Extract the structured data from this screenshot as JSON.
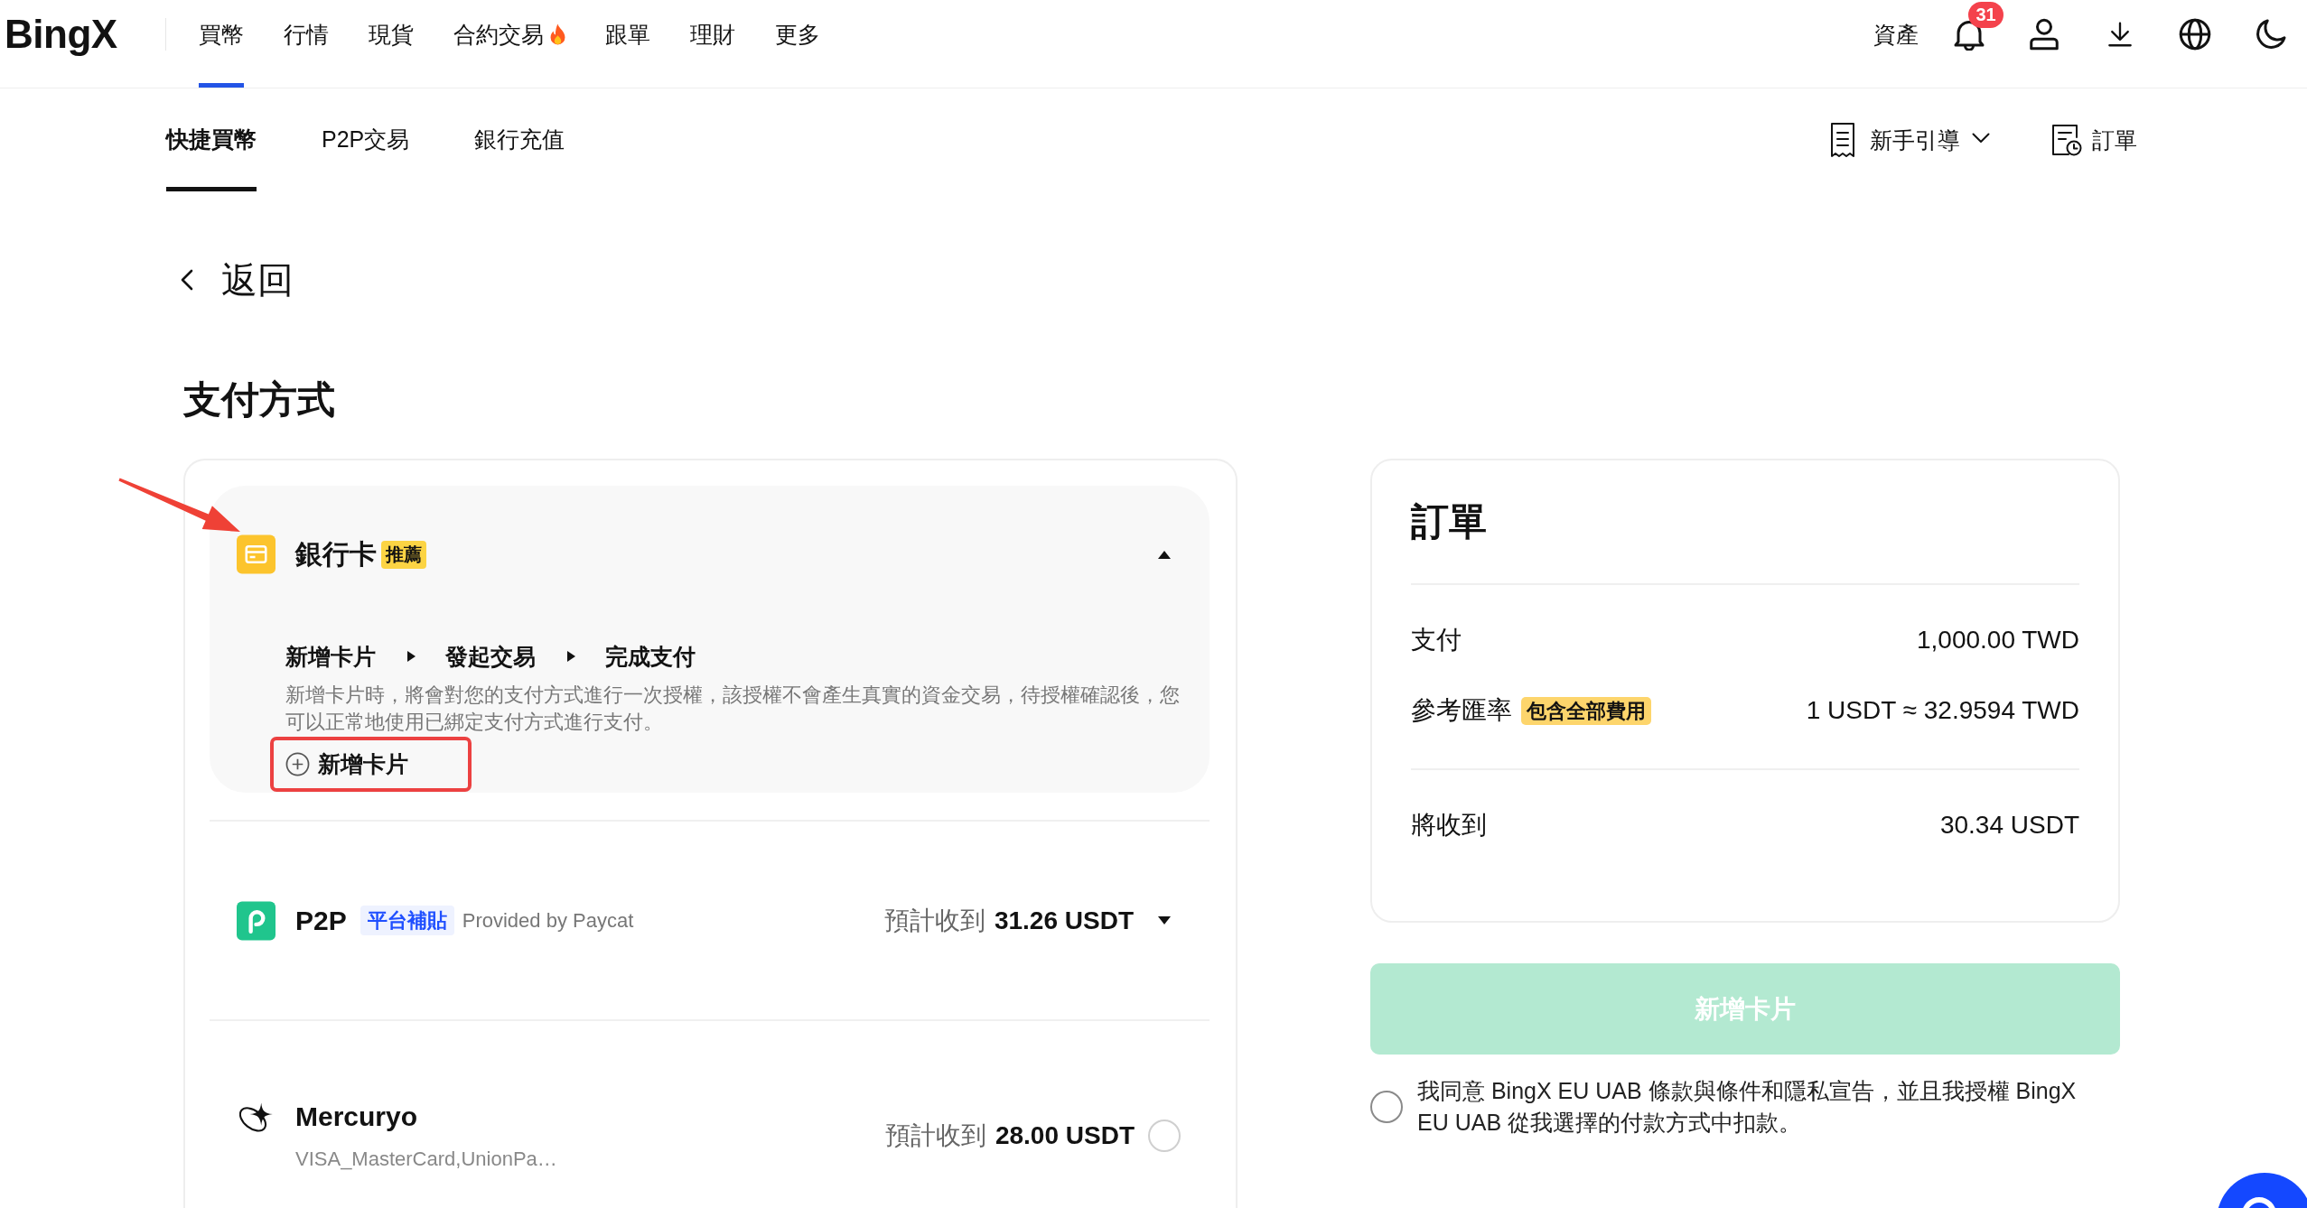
{
  "header": {
    "logo": "BingX",
    "nav": [
      {
        "label": "買幣",
        "selected": true,
        "hot": false
      },
      {
        "label": "行情",
        "selected": false,
        "hot": false
      },
      {
        "label": "現貨",
        "selected": false,
        "hot": false
      },
      {
        "label": "合約交易",
        "selected": false,
        "hot": true
      },
      {
        "label": "跟單",
        "selected": false,
        "hot": false
      },
      {
        "label": "理財",
        "selected": false,
        "hot": false
      },
      {
        "label": "更多",
        "selected": false,
        "hot": false
      }
    ],
    "assets": "資產",
    "notification_count": "31"
  },
  "subnav": {
    "tabs": [
      {
        "label": "快捷買幣",
        "selected": true
      },
      {
        "label": "P2P交易",
        "selected": false
      },
      {
        "label": "銀行充值",
        "selected": false
      }
    ],
    "guide": "新手引導",
    "orders": "訂單"
  },
  "back": "返回",
  "title": "支付方式",
  "payment_methods": [
    {
      "kind": "bank_card",
      "name": "銀行卡",
      "tag": "推薦",
      "expanded": true,
      "pointed_by_arrow": true,
      "steps": [
        "新增卡片",
        "發起交易",
        "完成支付"
      ],
      "description": "新增卡片時，將會對您的支付方式進行一次授權，該授權不會產生真實的資金交易，待授權確認後，您可以正常地使用已綁定支付方式進行支付。",
      "action": {
        "label": "新增卡片",
        "highlighted": true
      }
    },
    {
      "kind": "p2p",
      "name": "P2P",
      "tag": "平台補貼",
      "provider": "Provided by Paycat",
      "estimate_label": "預計收到",
      "estimate": "31.26 USDT",
      "expanded": false
    },
    {
      "kind": "mercuryo",
      "name": "Mercuryo",
      "subtitle": "VISA_MasterCard,UnionPa…",
      "estimate_label": "預計收到",
      "estimate": "28.00 USDT",
      "selected": false
    }
  ],
  "order": {
    "title": "訂單",
    "sections": [
      {
        "rows": [
          {
            "label": "支付",
            "value": "1,000.00 TWD"
          },
          {
            "label": "參考匯率",
            "tag": "包含全部費用",
            "value": "1 USDT ≈ 32.9594 TWD"
          }
        ]
      },
      {
        "rows": [
          {
            "label": "將收到",
            "value": "30.34 USDT"
          }
        ]
      }
    ]
  },
  "submit": {
    "label": "新增卡片",
    "disabled": true
  },
  "agreement": {
    "text": "我同意 BingX EU UAB 條款與條件和隱私宣告，並且我授權 BingX EU UAB 從我選擇的付款方式中扣款。",
    "checked": false
  }
}
